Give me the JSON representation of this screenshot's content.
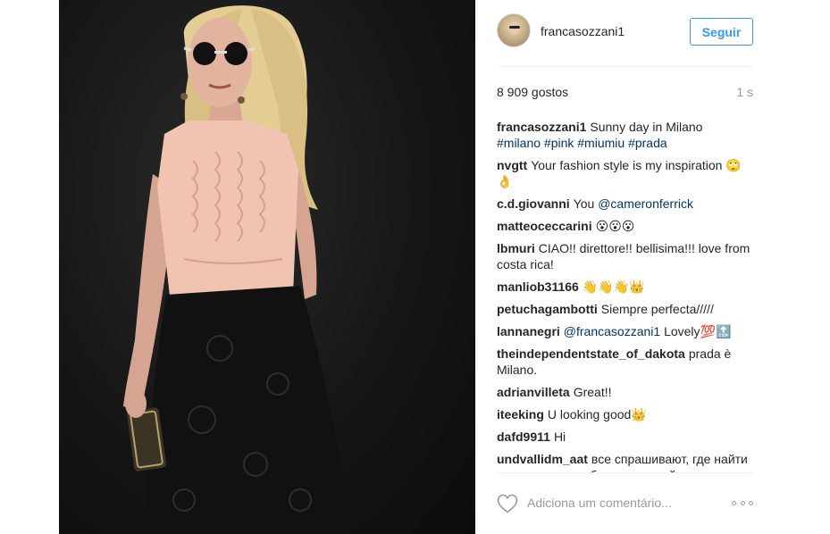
{
  "post": {
    "username": "francasozzani1",
    "follow_label": "Seguir",
    "likes": "8 909 gostos",
    "time_ago": "1 s",
    "caption": {
      "author": "francasozzani1",
      "text": "Sunny day in Milano",
      "hashtags": "#milano #pink #miumiu #prada"
    }
  },
  "comments": [
    {
      "author": "nvgtt",
      "text": "Your fashion style is my inspiration 🙄👌"
    },
    {
      "author": "c.d.giovanni",
      "text": "You",
      "mention": "@cameronferrick"
    },
    {
      "author": "matteoceccarini",
      "text": "😮😮😮"
    },
    {
      "author": "lbmuri",
      "text": "CIAO!! direttore!! bellisima!!! love from costa rica!"
    },
    {
      "author": "manliob31166",
      "text": "👋👋👋👑"
    },
    {
      "author": "petuchagambotti",
      "text": "Siempre perfecta/////"
    },
    {
      "author": "lannanegri",
      "text": "Lovely💯🔝",
      "mention": "@francasozzani1"
    },
    {
      "author": "theindependentstate_of_dakota",
      "text": "prada è Milano."
    },
    {
      "author": "adrianvilleta",
      "text": "Great!!"
    },
    {
      "author": "iteeking",
      "text": "U looking good👑"
    },
    {
      "author": "dafd9911",
      "text": "Hi"
    },
    {
      "author": "undvallidm_aat",
      "text": "все спрашивают, где найти оригинальную обувь по низкой"
    }
  ],
  "actions": {
    "comment_placeholder": "Adiciona um comentário...",
    "heart_icon": "heart-icon",
    "more_icon": "more-options-icon"
  },
  "colors": {
    "link": "#003569",
    "accent": "#3897f0",
    "muted": "#999999"
  }
}
